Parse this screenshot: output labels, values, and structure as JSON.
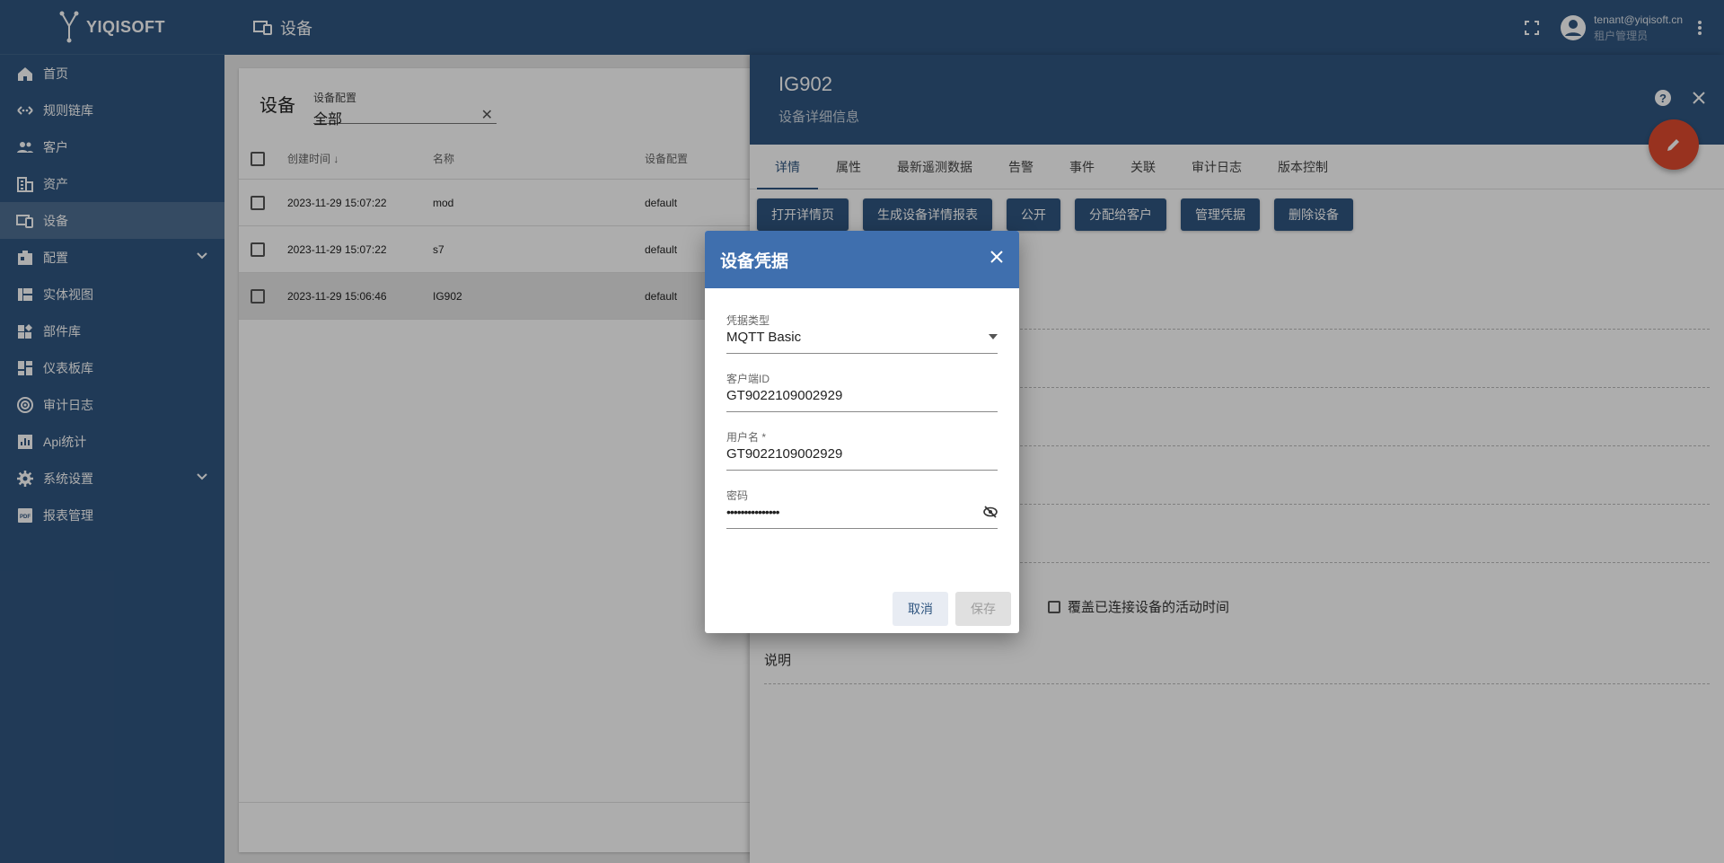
{
  "app": {
    "logo_text": "YIQISOFT"
  },
  "sidebar": {
    "items": [
      {
        "label": "首页",
        "icon": "home-icon"
      },
      {
        "label": "规则链库",
        "icon": "rule-chain-icon"
      },
      {
        "label": "客户",
        "icon": "customers-icon"
      },
      {
        "label": "资产",
        "icon": "asset-icon"
      },
      {
        "label": "设备",
        "icon": "device-icon",
        "active": true
      },
      {
        "label": "配置",
        "icon": "profile-icon",
        "expandable": true
      },
      {
        "label": "实体视图",
        "icon": "entity-view-icon"
      },
      {
        "label": "部件库",
        "icon": "widget-library-icon"
      },
      {
        "label": "仪表板库",
        "icon": "dashboard-icon"
      },
      {
        "label": "审计日志",
        "icon": "audit-log-icon"
      },
      {
        "label": "Api统计",
        "icon": "api-stats-icon"
      },
      {
        "label": "系统设置",
        "icon": "settings-icon",
        "expandable": true
      },
      {
        "label": "报表管理",
        "icon": "report-icon"
      }
    ]
  },
  "topbar": {
    "title": "设备",
    "user_email": "tenant@yiqisoft.cn",
    "user_role": "租户管理员"
  },
  "device_list": {
    "title": "设备",
    "filter_label": "设备配置",
    "filter_value": "全部",
    "columns": {
      "created": "创建时间",
      "name": "名称",
      "profile": "设备配置"
    },
    "rows": [
      {
        "created": "2023-11-29 15:07:22",
        "name": "mod",
        "profile": "default"
      },
      {
        "created": "2023-11-29 15:07:22",
        "name": "s7",
        "profile": "default"
      },
      {
        "created": "2023-11-29 15:06:46",
        "name": "IG902",
        "profile": "default"
      }
    ]
  },
  "detail": {
    "title": "IG902",
    "subtitle": "设备详细信息",
    "tabs": [
      "详情",
      "属性",
      "最新遥测数据",
      "告警",
      "事件",
      "关联",
      "审计日志",
      "版本控制"
    ],
    "buttons": [
      "打开详情页",
      "生成设备详情报表",
      "公开",
      "分配给客户",
      "管理凭据",
      "删除设备"
    ],
    "override_label": "覆盖已连接设备的活动时间",
    "description_label": "说明"
  },
  "dialog": {
    "title": "设备凭据",
    "credential_type_label": "凭据类型",
    "credential_type_value": "MQTT Basic",
    "client_id_label": "客户端ID",
    "client_id_value": "GT9022109002929",
    "username_label": "用户名 *",
    "username_value": "GT9022109002929",
    "password_label": "密码",
    "password_value": "•••••••••••••••",
    "cancel_label": "取消",
    "save_label": "保存"
  },
  "colors": {
    "primary": "#305680",
    "dialog_header": "#3f6fae",
    "fab": "#e04a2f"
  }
}
